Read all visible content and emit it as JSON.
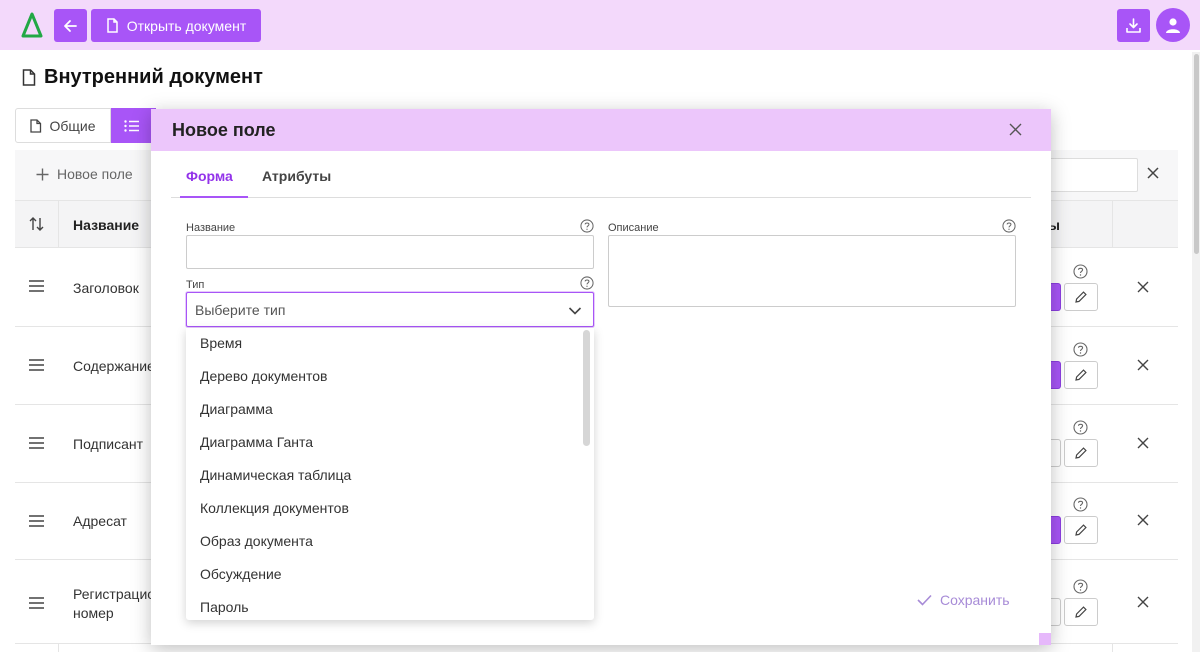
{
  "topbar": {
    "logo": "Δ",
    "open_document": "Открыть документ",
    "icons": [
      "arrow-left-icon",
      "file-icon",
      "download-icon",
      "user-icon"
    ]
  },
  "page": {
    "title": "Внутренний документ"
  },
  "tabs": {
    "general": "Общие"
  },
  "table": {
    "new_field": "Новое поле",
    "col_name": "Название",
    "col_right": "ы",
    "rows": [
      {
        "label": "Заголовок"
      },
      {
        "label": "Содержание"
      },
      {
        "label": "Подписант"
      },
      {
        "label": "Адресат"
      },
      {
        "label": "Регистрацио",
        "label2": "номер"
      }
    ]
  },
  "modal": {
    "title": "Новое поле",
    "tabs": [
      "Форма",
      "Атрибуты"
    ],
    "name_label": "Название",
    "name_value": "",
    "description_label": "Описание",
    "description_value": "",
    "type_label": "Тип",
    "type_placeholder": "Выберите тип",
    "type_options": [
      "Время",
      "Дерево документов",
      "Диаграмма",
      "Диаграмма Ганта",
      "Динамическая таблица",
      "Коллекция документов",
      "Образ документа",
      "Обсуждение",
      "Пароль"
    ],
    "save_label": "Сохранить"
  },
  "colors": {
    "accent": "#a855f7",
    "topbar_bg": "#f3d9fb",
    "modal_header_bg": "#ecc6fb",
    "logo_green": "#22a845"
  }
}
